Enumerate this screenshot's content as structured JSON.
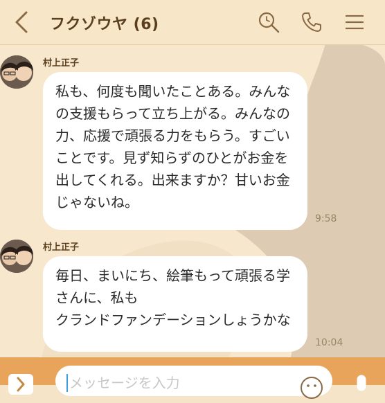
{
  "header": {
    "title": "フクゾウヤ (6)",
    "icons": [
      "back-icon",
      "search-icon",
      "phone-icon",
      "menu-icon"
    ]
  },
  "messages": [
    {
      "sender": "村上正子",
      "text": "私も、何度も聞いたことある。みんなの支援もらって立ち上がる。みんなの力、応援で頑張る力をもらう。すごいことです。見ず知らずのひとがお金を出してくれる。出来ますか？甘いお金じゃないね。",
      "time": "9:58"
    },
    {
      "sender": "村上正子",
      "text": "毎日、まいにち、絵筆もって頑張る学さんに、私も\nクランドファンデーションしょうかな",
      "time": "10:04"
    }
  ],
  "input": {
    "placeholder": "メッセージを入力"
  },
  "colors": {
    "header_bg": "#f8e6c8",
    "chat_bg": "#f7e7cd",
    "input_bar": "#e8a45a",
    "title_text": "#5a3f1e"
  }
}
